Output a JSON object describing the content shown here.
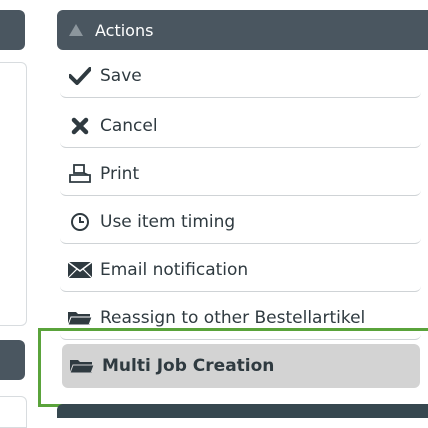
{
  "actions": {
    "title": "Actions",
    "items": [
      {
        "label": "Save",
        "icon": "checkmark-icon"
      },
      {
        "label": "Cancel",
        "icon": "x-icon"
      },
      {
        "label": "Print",
        "icon": "printer-icon"
      },
      {
        "label": "Use item timing",
        "icon": "clock-icon"
      },
      {
        "label": "Email notification",
        "icon": "envelope-icon"
      },
      {
        "label": "Reassign to other Bestellartikel",
        "icon": "folder-icon"
      },
      {
        "label": "Multi Job Creation",
        "icon": "folder-icon",
        "selected": true
      }
    ]
  },
  "colors": {
    "header_bg": "#4a5660",
    "highlight_border": "#5aa33b",
    "selected_bg": "#d3d3d3"
  }
}
